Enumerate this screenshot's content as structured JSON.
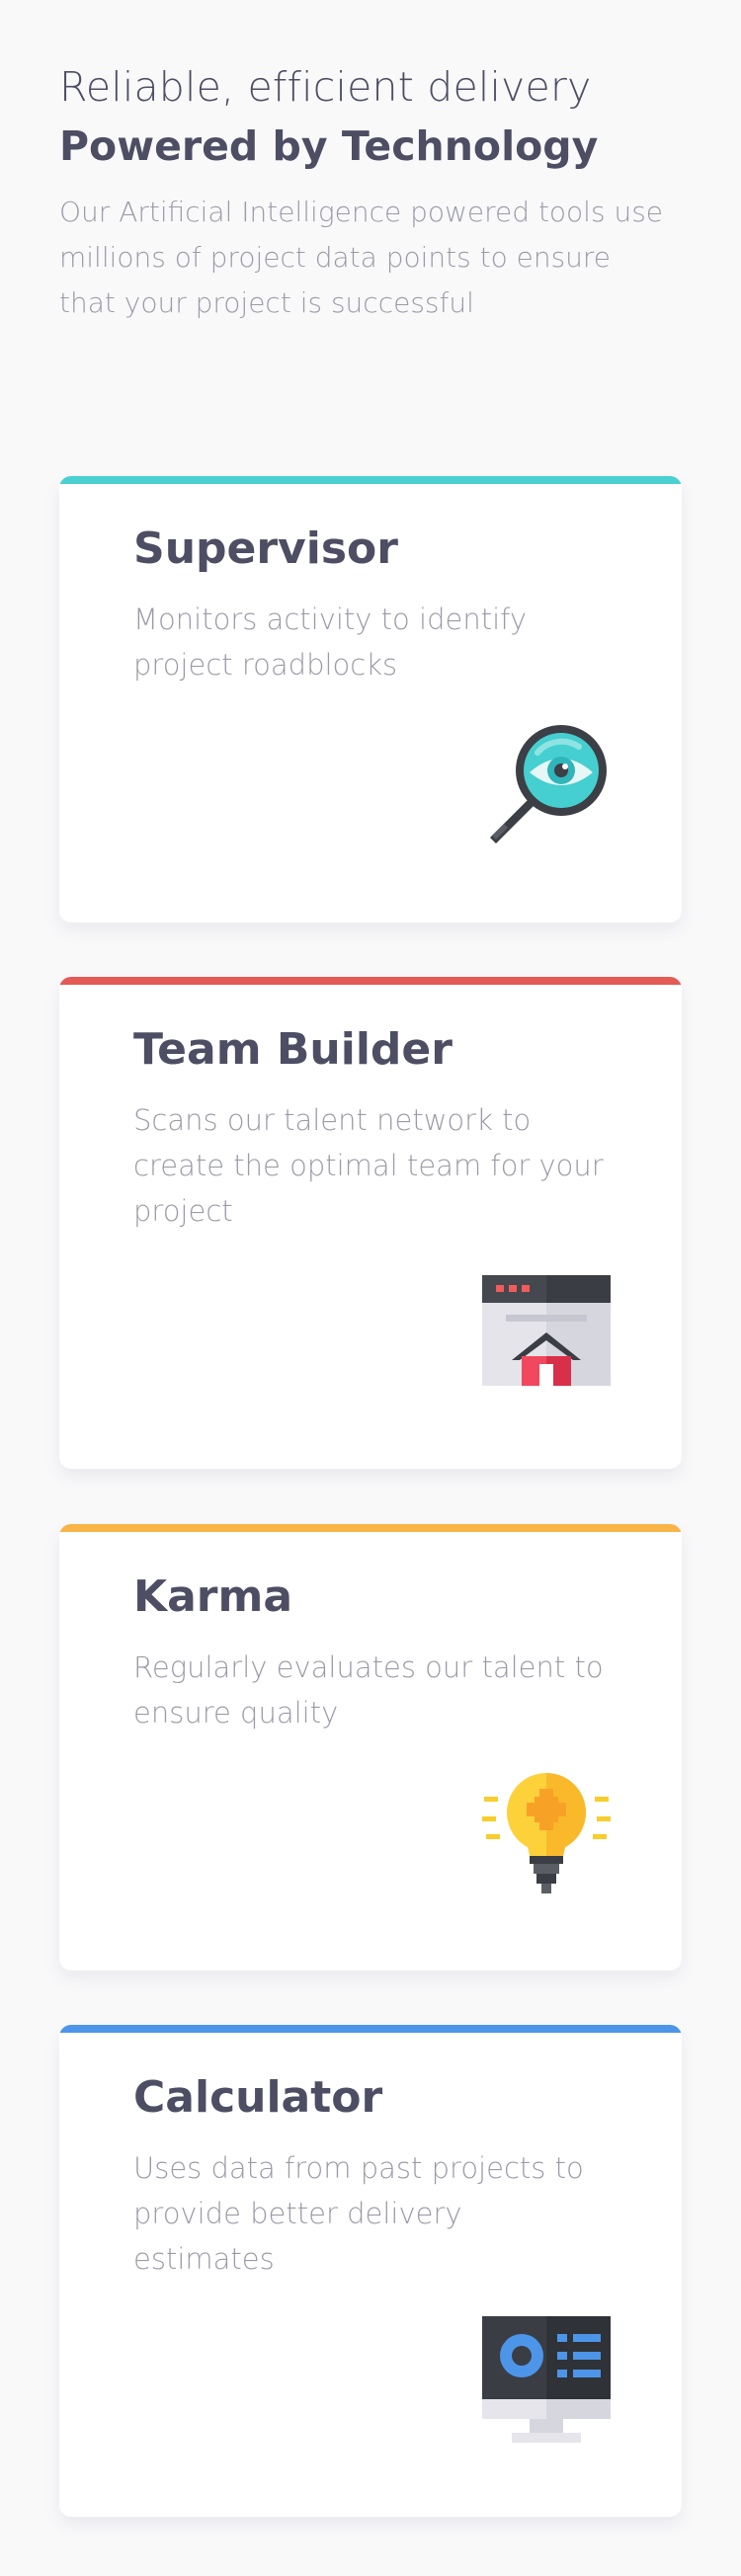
{
  "hero": {
    "eyebrow": "Reliable, efficient delivery",
    "title": "Powered by Technology",
    "description": "Our Artificial Intelligence powered tools use millions of project data points to ensure that your project is successful"
  },
  "cards": [
    {
      "title": "Supervisor",
      "description": "Monitors activity to identify project roadblocks",
      "accent_color": "#4ad0d1",
      "icon": "magnifier-eye-icon"
    },
    {
      "title": "Team Builder",
      "description": "Scans our talent network to create the optimal team for your project",
      "accent_color": "#e45a54",
      "icon": "browser-house-icon"
    },
    {
      "title": "Karma",
      "description": "Regularly evaluates our talent to ensure quality",
      "accent_color": "#f9b448",
      "icon": "lightbulb-icon"
    },
    {
      "title": "Calculator",
      "description": "Uses data from past projects to provide better delivery estimates",
      "accent_color": "#4d95e8",
      "icon": "monitor-dashboard-icon"
    }
  ]
}
